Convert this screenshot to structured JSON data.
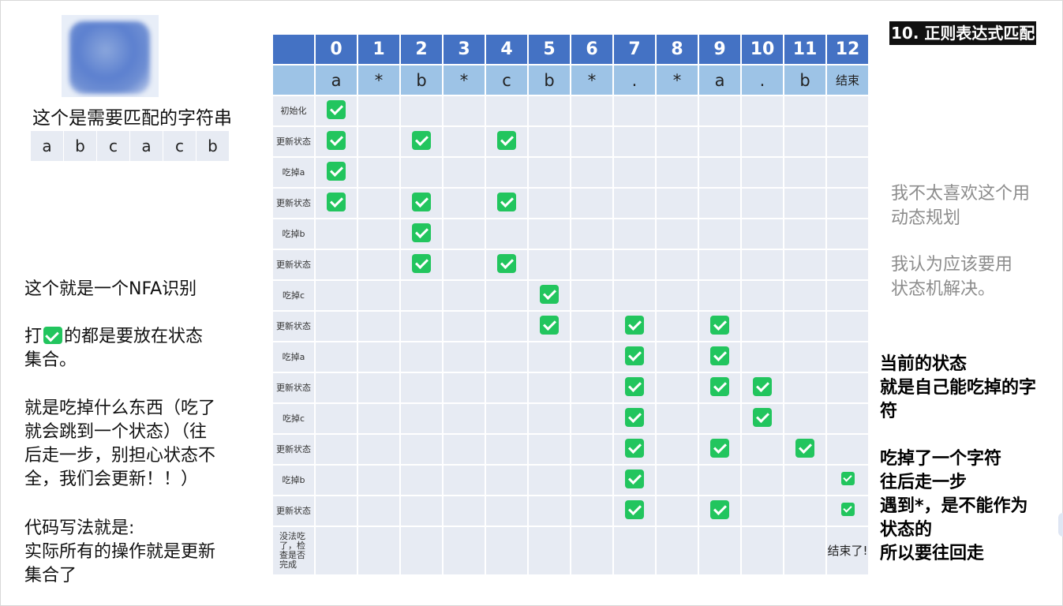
{
  "title": "10. 正则表达式匹配",
  "target_label": "这个是需要匹配的字符串",
  "target_chars": [
    "a",
    "b",
    "c",
    "a",
    "c",
    "b"
  ],
  "left_notes": [
    "这个就是一个NFA识别",
    "",
    "打 ✓ 的都是要放在状态集合。",
    "",
    "就是吃掉什么东西（吃了就会跳到一个状态）（往后走一步，别担心状态不全，我们会更新！！）",
    "",
    "代码写法就是:",
    "实际所有的操作就是更新集合了"
  ],
  "left_note_blocks": {
    "nfa": "这个就是一个NFA识别",
    "check_pre": "打",
    "check_post": "的都是要放在状态",
    "check_line2": "集合。",
    "eat": [
      "就是吃掉什么东西（吃了",
      "就会跳到一个状态）（往",
      "后走一步，别担心状态不",
      "全，我们会更新！！）"
    ],
    "code": [
      "代码写法就是:",
      "实际所有的操作就是更新",
      "集合了"
    ]
  },
  "right_gray": {
    "p1": [
      "我不太喜欢这个用",
      "动态规划"
    ],
    "p2": [
      "我认为应该要用",
      "状态机解决。"
    ]
  },
  "right_bold": {
    "p1": [
      "当前的状态",
      "就是自己能吃掉的字",
      "符"
    ],
    "p2": [
      "吃掉了一个字符",
      "往后走一步",
      "遇到*，是不能作为",
      "状态的",
      "所以要往回走"
    ]
  },
  "table": {
    "header_numbers": [
      "0",
      "1",
      "2",
      "3",
      "4",
      "5",
      "6",
      "7",
      "8",
      "9",
      "10",
      "11",
      "12"
    ],
    "header_chars": [
      "a",
      "*",
      "b",
      "*",
      "c",
      "b",
      "*",
      ".",
      "*",
      "a",
      ".",
      "b",
      "结束"
    ],
    "rows": [
      {
        "label": "初始化",
        "checks": [
          0
        ]
      },
      {
        "label": "更新状态",
        "checks": [
          0,
          2,
          4
        ]
      },
      {
        "label": "吃掉a",
        "checks": [
          0
        ]
      },
      {
        "label": "更新状态",
        "checks": [
          0,
          2,
          4
        ]
      },
      {
        "label": "吃掉b",
        "checks": [
          2
        ]
      },
      {
        "label": "更新状态",
        "checks": [
          2,
          4
        ]
      },
      {
        "label": "吃掉c",
        "checks": [
          5
        ]
      },
      {
        "label": "更新状态",
        "checks": [
          5,
          7,
          9
        ]
      },
      {
        "label": "吃掉a",
        "checks": [
          7,
          9
        ]
      },
      {
        "label": "更新状态",
        "checks": [
          7,
          9,
          10
        ]
      },
      {
        "label": "吃掉c",
        "checks": [
          7,
          10
        ]
      },
      {
        "label": "更新状态",
        "checks": [
          7,
          9,
          11
        ]
      },
      {
        "label": "吃掉b",
        "checks": [
          7,
          12
        ]
      },
      {
        "label": "更新状态",
        "checks": [
          7,
          9,
          12
        ]
      },
      {
        "label": "没法吃了，检查是否完成",
        "checks": [],
        "end_text": "结束了!"
      }
    ]
  },
  "colors": {
    "header_blue": "#4472c4",
    "subheader_blue": "#9dc3e6",
    "cell_bg": "#e7ebf3",
    "check_green": "#22c55e",
    "note_gray": "#8c8c8c"
  }
}
